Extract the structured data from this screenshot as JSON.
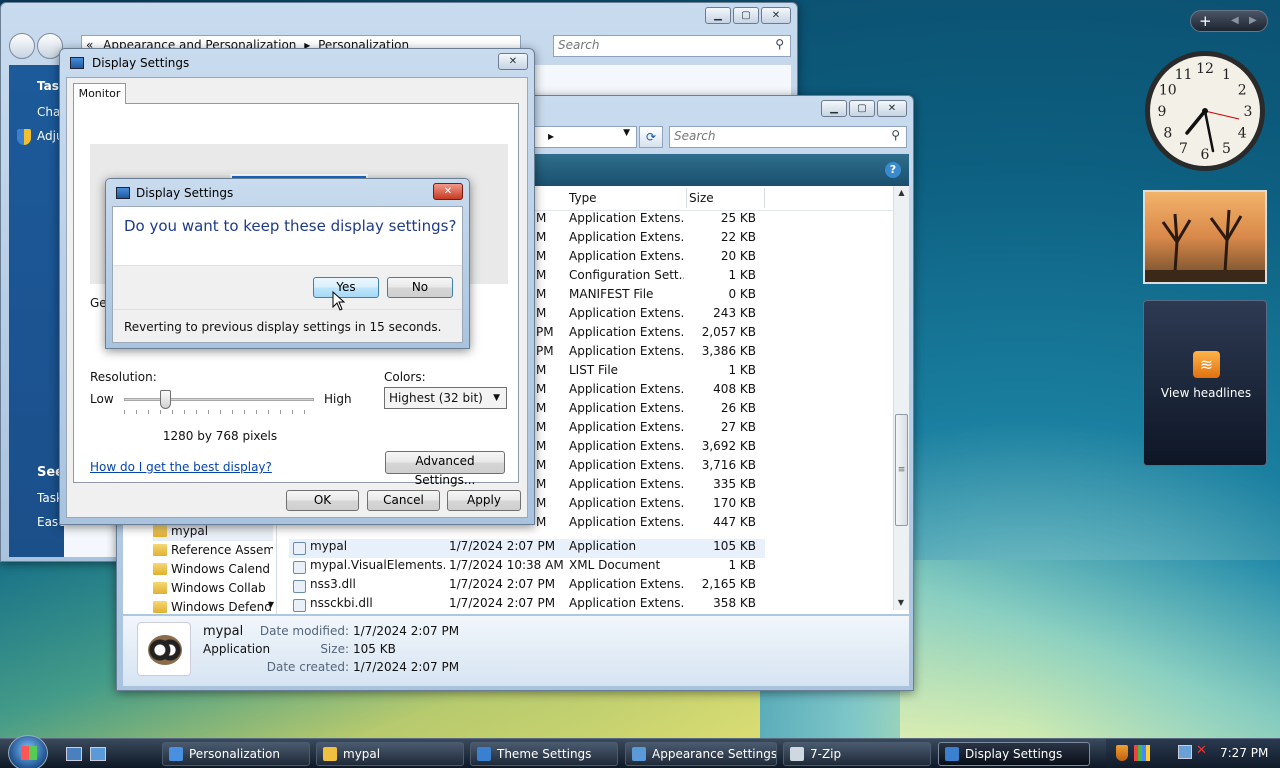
{
  "personalization_window": {
    "breadcrumb_prefix": "«",
    "crumb1": "Appearance and Personalization",
    "crumb_sep": "▸",
    "crumb2": "Personalization",
    "search_placeholder": "Search",
    "side_tasks": "Task",
    "side_cha": "Cha",
    "side_adj": "Adju",
    "side_see": "See",
    "side_task2": "Task",
    "side_ease": "Ease"
  },
  "display_settings": {
    "title": "Display Settings",
    "tab": "Monitor",
    "gen_label": "Gen",
    "resolution_label": "Resolution:",
    "low": "Low",
    "high": "High",
    "pixels": "1280 by 768 pixels",
    "colors_label": "Colors:",
    "colors_value": "Highest (32 bit)",
    "help_link": "How do I get the best display?",
    "advanced_button": "Advanced Settings...",
    "ok": "OK",
    "cancel": "Cancel",
    "apply": "Apply",
    "slider_fraction": 0.2
  },
  "confirm_dialog": {
    "title": "Display Settings",
    "question": "Do you want to keep these display settings?",
    "yes": "Yes",
    "no": "No",
    "countdown": "Reverting to previous display settings in 15 seconds."
  },
  "explorer": {
    "search_placeholder": "Search",
    "address_sep": "▸",
    "col_type": "Type",
    "col_size": "Size",
    "rows": [
      {
        "d": "M",
        "t": "Application Extens...",
        "s": "25 KB"
      },
      {
        "d": "M",
        "t": "Application Extens...",
        "s": "22 KB"
      },
      {
        "d": "M",
        "t": "Application Extens...",
        "s": "20 KB"
      },
      {
        "d": "M",
        "t": "Configuration Sett...",
        "s": "1 KB"
      },
      {
        "d": "M",
        "t": "MANIFEST File",
        "s": "0 KB"
      },
      {
        "d": "M",
        "t": "Application Extens...",
        "s": "243 KB"
      },
      {
        "d": "PM",
        "t": "Application Extens...",
        "s": "2,057 KB"
      },
      {
        "d": "PM",
        "t": "Application Extens...",
        "s": "3,386 KB"
      },
      {
        "d": "M",
        "t": "LIST File",
        "s": "1 KB"
      },
      {
        "d": "M",
        "t": "Application Extens...",
        "s": "408 KB"
      },
      {
        "d": "M",
        "t": "Application Extens...",
        "s": "26 KB"
      },
      {
        "d": "M",
        "t": "Application Extens...",
        "s": "27 KB"
      },
      {
        "d": "M",
        "t": "Application Extens...",
        "s": "3,692 KB"
      },
      {
        "d": "M",
        "t": "Application Extens...",
        "s": "3,716 KB"
      },
      {
        "d": "M",
        "t": "Application Extens...",
        "s": "335 KB"
      },
      {
        "d": "M",
        "t": "Application Extens...",
        "s": "170 KB"
      },
      {
        "d": "M",
        "t": "Application Extens...",
        "s": "447 KB"
      }
    ],
    "full_rows": [
      {
        "n": "mypal",
        "d": "1/7/2024 2:07 PM",
        "t": "Application",
        "s": "105 KB"
      },
      {
        "n": "mypal.VisualElements...",
        "d": "1/7/2024 10:38 AM",
        "t": "XML Document",
        "s": "1 KB"
      },
      {
        "n": "nss3.dll",
        "d": "1/7/2024 2:07 PM",
        "t": "Application Extens...",
        "s": "2,165 KB"
      },
      {
        "n": "nssckbi.dll",
        "d": "1/7/2024 2:07 PM",
        "t": "Application Extens...",
        "s": "358 KB"
      }
    ],
    "tree": [
      "mypal",
      "Reference Assem",
      "Windows Calend",
      "Windows Collab",
      "Windows Defend"
    ],
    "details": {
      "name": "mypal",
      "kind": "Application",
      "modified_label": "Date modified:",
      "modified": "1/7/2024 2:07 PM",
      "size_label": "Size:",
      "size": "105 KB",
      "created_label": "Date created:",
      "created": "1/7/2024 2:07 PM"
    }
  },
  "gadgets": {
    "headlines": "View headlines",
    "clock_numbers": [
      "12",
      "1",
      "2",
      "3",
      "4",
      "5",
      "6",
      "7",
      "8",
      "9",
      "10",
      "11"
    ]
  },
  "taskbar": {
    "items": [
      "Personalization",
      "mypal",
      "Theme Settings",
      "Appearance Settings",
      "7-Zip",
      "Display Settings"
    ],
    "time": "7:27 PM"
  },
  "colors": {
    "accent": "#3c7fb1",
    "link": "#0645ad",
    "dialog_question": "#1e3a8a"
  }
}
